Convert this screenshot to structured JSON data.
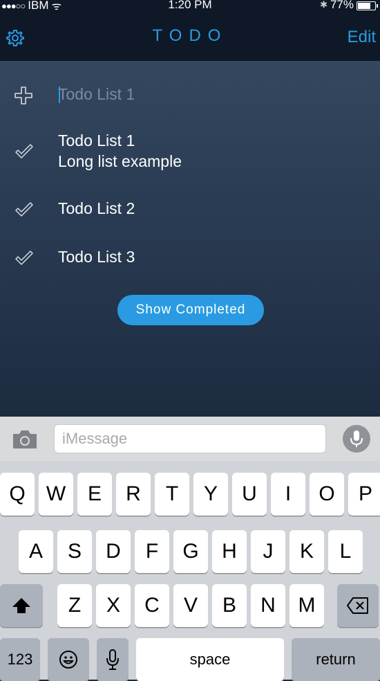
{
  "status_bar": {
    "signal": "●●●○○",
    "carrier": "IBM",
    "wifi_glyph": "ᯤ",
    "time": "1:20 PM",
    "bluetooth_glyph": "✱",
    "battery_percent": "77%",
    "battery_level": 0.77
  },
  "nav": {
    "title": "TODO",
    "edit_label": "Edit",
    "settings_icon": "gear-icon"
  },
  "new_item": {
    "placeholder": "Todo List 1",
    "icon": "plus-icon"
  },
  "lists": [
    {
      "title": "Todo List 1",
      "subtitle": "Long list example",
      "icon": "checkmark-icon"
    },
    {
      "title": "Todo List 2",
      "icon": "checkmark-icon"
    },
    {
      "title": "Todo List 3",
      "icon": "checkmark-icon"
    }
  ],
  "show_completed_label": "Show Completed",
  "message_bar": {
    "placeholder": "iMessage",
    "camera_icon": "camera-icon",
    "mic_icon": "microphone-icon"
  },
  "keyboard": {
    "row1": [
      "Q",
      "W",
      "E",
      "R",
      "T",
      "Y",
      "U",
      "I",
      "O",
      "P"
    ],
    "row2": [
      "A",
      "S",
      "D",
      "F",
      "G",
      "H",
      "J",
      "K",
      "L"
    ],
    "row3": [
      "Z",
      "X",
      "C",
      "V",
      "B",
      "N",
      "M"
    ],
    "numbers_label": "123",
    "space_label": "space",
    "return_label": "return",
    "shift_icon": "shift-icon",
    "delete_icon": "delete-icon",
    "emoji_icon": "emoji-icon",
    "dictation_icon": "microphone-icon"
  },
  "colors": {
    "accent": "#2a9be2",
    "nav_background": "#0e1826",
    "content_top": "#34475f",
    "content_bottom": "#1d2b40",
    "keyboard_background": "#d0d3d8"
  }
}
